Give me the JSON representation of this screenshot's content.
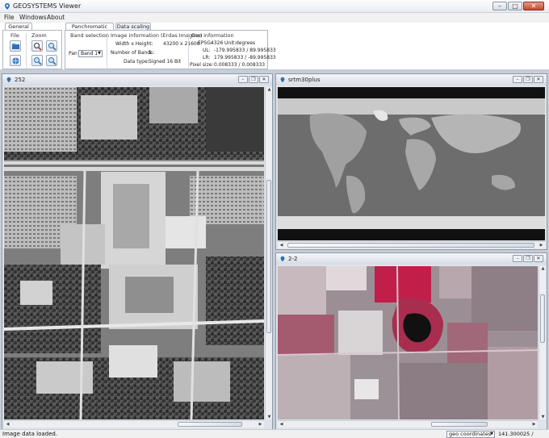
{
  "window": {
    "title": "GEOSYSTEMS Viewer"
  },
  "menu": [
    "File",
    "Windows",
    "About"
  ],
  "ribbon": {
    "left_tab": "General",
    "groups": {
      "file": "File",
      "zoom": "Zoom"
    },
    "tabs": [
      "Panchromatic Image",
      "Data scaling"
    ],
    "band_selection": {
      "title": "Band selection",
      "pan_label": "Pan",
      "pan_value": "Band 1"
    },
    "image_info": {
      "title": "Image information (Erdas Imagine)",
      "rows": [
        {
          "label": "Width x Height:",
          "value": "43200 x 21600"
        },
        {
          "label": "Number of Bands:",
          "value": "1"
        },
        {
          "label": "Data type:",
          "value": "Signed 16 Bit"
        }
      ]
    },
    "geo_info": {
      "title": "Geo information",
      "epsg_label": "EPSG:",
      "epsg_value": "4326",
      "unit_label": "Unit:",
      "unit_value": "degrees",
      "rows": [
        {
          "label": "UL:",
          "value": "-179.995833 / 89.995833"
        },
        {
          "label": "LR:",
          "value": "179.995833 / -89.995833"
        },
        {
          "label": "Pixel size:",
          "value": "0.008333 / 0.008333"
        }
      ]
    }
  },
  "windows": {
    "left": {
      "title": "252"
    },
    "top_right": {
      "title": "srtm30plus"
    },
    "bottom_right": {
      "title": "2-2"
    }
  },
  "status": {
    "message": "Image data loaded.",
    "coord_mode": "geo coordinates",
    "coords": "141.300025 / 34.241748"
  },
  "icons": {
    "app": "globe-pin-icon",
    "open": "open-file-icon",
    "save": "save-globe-icon",
    "zoom_in": "zoom-in-icon",
    "zoom_out": "zoom-out-icon",
    "zoom_fit": "zoom-fit-icon",
    "zoom_100": "zoom-actual-icon"
  },
  "colors": {
    "accent": "#2f6fb3",
    "window_bg": "#c7cdd6"
  }
}
